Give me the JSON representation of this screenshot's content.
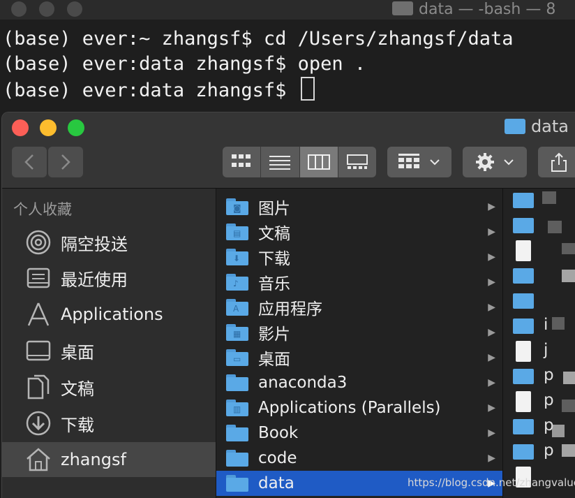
{
  "terminal": {
    "title": "data — -bash — 8",
    "lines": [
      "(base) ever:~ zhangsf$ cd /Users/zhangsf/data",
      "(base) ever:data zhangsf$ open .",
      "(base) ever:data zhangsf$ "
    ]
  },
  "finder": {
    "title": "data",
    "sidebar": {
      "heading": "个人收藏",
      "items": [
        {
          "label": "隔空投送",
          "icon": "airdrop-icon"
        },
        {
          "label": "最近使用",
          "icon": "recents-icon"
        },
        {
          "label": "Applications",
          "icon": "applications-icon"
        },
        {
          "label": "桌面",
          "icon": "desktop-icon"
        },
        {
          "label": "文稿",
          "icon": "documents-icon"
        },
        {
          "label": "下载",
          "icon": "downloads-icon"
        },
        {
          "label": "zhangsf",
          "icon": "home-icon"
        }
      ],
      "selected": "zhangsf"
    },
    "column1": [
      {
        "label": "图片",
        "glyph": "◙"
      },
      {
        "label": "文稿",
        "glyph": "▤"
      },
      {
        "label": "下载",
        "glyph": "⬇"
      },
      {
        "label": "音乐",
        "glyph": "♪"
      },
      {
        "label": "应用程序",
        "glyph": "A"
      },
      {
        "label": "影片",
        "glyph": "▦"
      },
      {
        "label": "桌面",
        "glyph": "▭"
      },
      {
        "label": "anaconda3",
        "glyph": ""
      },
      {
        "label": "Applications (Parallels)",
        "glyph": "▥"
      },
      {
        "label": "Book",
        "glyph": ""
      },
      {
        "label": "code",
        "glyph": ""
      },
      {
        "label": "data",
        "glyph": ""
      }
    ],
    "selected_folder": "data",
    "column2_chars": [
      "",
      "",
      "",
      "",
      "",
      "i",
      "j",
      "p",
      "p",
      "p",
      "p",
      ""
    ]
  },
  "watermark": "https://blog.csdn.net/zhangvalue"
}
